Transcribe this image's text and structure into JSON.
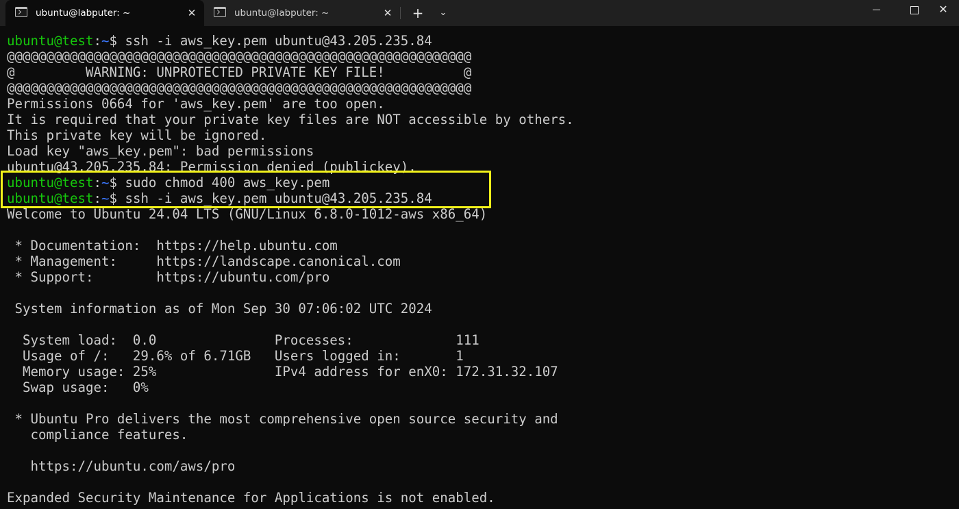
{
  "tabs": [
    {
      "label": "ubuntu@labputer: ~",
      "active": true
    },
    {
      "label": "ubuntu@labputer: ~",
      "active": false
    }
  ],
  "tab_bar": {
    "new_tab": "+",
    "dropdown": "⌄",
    "close_tab": "✕"
  },
  "window_controls": {
    "close": "✕"
  },
  "icons": {
    "tab_icon": "terminal-icon",
    "new_tab": "plus-icon",
    "dropdown": "chevron-down-icon",
    "minimize": "minimize-icon",
    "maximize": "maximize-icon",
    "close": "close-icon"
  },
  "colors": {
    "background": "#0c0c0c",
    "text": "#cccccc",
    "prompt_user": "#16c60c",
    "prompt_path": "#3b78ff",
    "highlight": "#f2f21a"
  },
  "prompt": {
    "user_host": "ubuntu@test",
    "colon": ":",
    "path": "~",
    "dollar": "$"
  },
  "terminal_lines": [
    {
      "type": "prompt",
      "command": " ssh -i aws_key.pem ubuntu@43.205.235.84"
    },
    {
      "type": "output",
      "text": "@@@@@@@@@@@@@@@@@@@@@@@@@@@@@@@@@@@@@@@@@@@@@@@@@@@@@@@@@@@"
    },
    {
      "type": "output",
      "text": "@         WARNING: UNPROTECTED PRIVATE KEY FILE!          @"
    },
    {
      "type": "output",
      "text": "@@@@@@@@@@@@@@@@@@@@@@@@@@@@@@@@@@@@@@@@@@@@@@@@@@@@@@@@@@@"
    },
    {
      "type": "output",
      "text": "Permissions 0664 for 'aws_key.pem' are too open."
    },
    {
      "type": "output",
      "text": "It is required that your private key files are NOT accessible by others."
    },
    {
      "type": "output",
      "text": "This private key will be ignored."
    },
    {
      "type": "output",
      "text": "Load key \"aws_key.pem\": bad permissions"
    },
    {
      "type": "output",
      "text": "ubuntu@43.205.235.84: Permission denied (publickey)."
    },
    {
      "type": "prompt",
      "command": " sudo chmod 400 aws_key.pem"
    },
    {
      "type": "prompt",
      "command": " ssh -i aws_key.pem ubuntu@43.205.235.84"
    },
    {
      "type": "output",
      "text": "Welcome to Ubuntu 24.04 LTS (GNU/Linux 6.8.0-1012-aws x86_64)"
    },
    {
      "type": "output",
      "text": ""
    },
    {
      "type": "output",
      "text": " * Documentation:  https://help.ubuntu.com"
    },
    {
      "type": "output",
      "text": " * Management:     https://landscape.canonical.com"
    },
    {
      "type": "output",
      "text": " * Support:        https://ubuntu.com/pro"
    },
    {
      "type": "output",
      "text": ""
    },
    {
      "type": "output",
      "text": " System information as of Mon Sep 30 07:06:02 UTC 2024"
    },
    {
      "type": "output",
      "text": ""
    },
    {
      "type": "output",
      "text": "  System load:  0.0               Processes:             111"
    },
    {
      "type": "output",
      "text": "  Usage of /:   29.6% of 6.71GB   Users logged in:       1"
    },
    {
      "type": "output",
      "text": "  Memory usage: 25%               IPv4 address for enX0: 172.31.32.107"
    },
    {
      "type": "output",
      "text": "  Swap usage:   0%"
    },
    {
      "type": "output",
      "text": ""
    },
    {
      "type": "output",
      "text": " * Ubuntu Pro delivers the most comprehensive open source security and"
    },
    {
      "type": "output",
      "text": "   compliance features."
    },
    {
      "type": "output",
      "text": ""
    },
    {
      "type": "output",
      "text": "   https://ubuntu.com/aws/pro"
    },
    {
      "type": "output",
      "text": ""
    },
    {
      "type": "output",
      "text": "Expanded Security Maintenance for Applications is not enabled."
    }
  ]
}
